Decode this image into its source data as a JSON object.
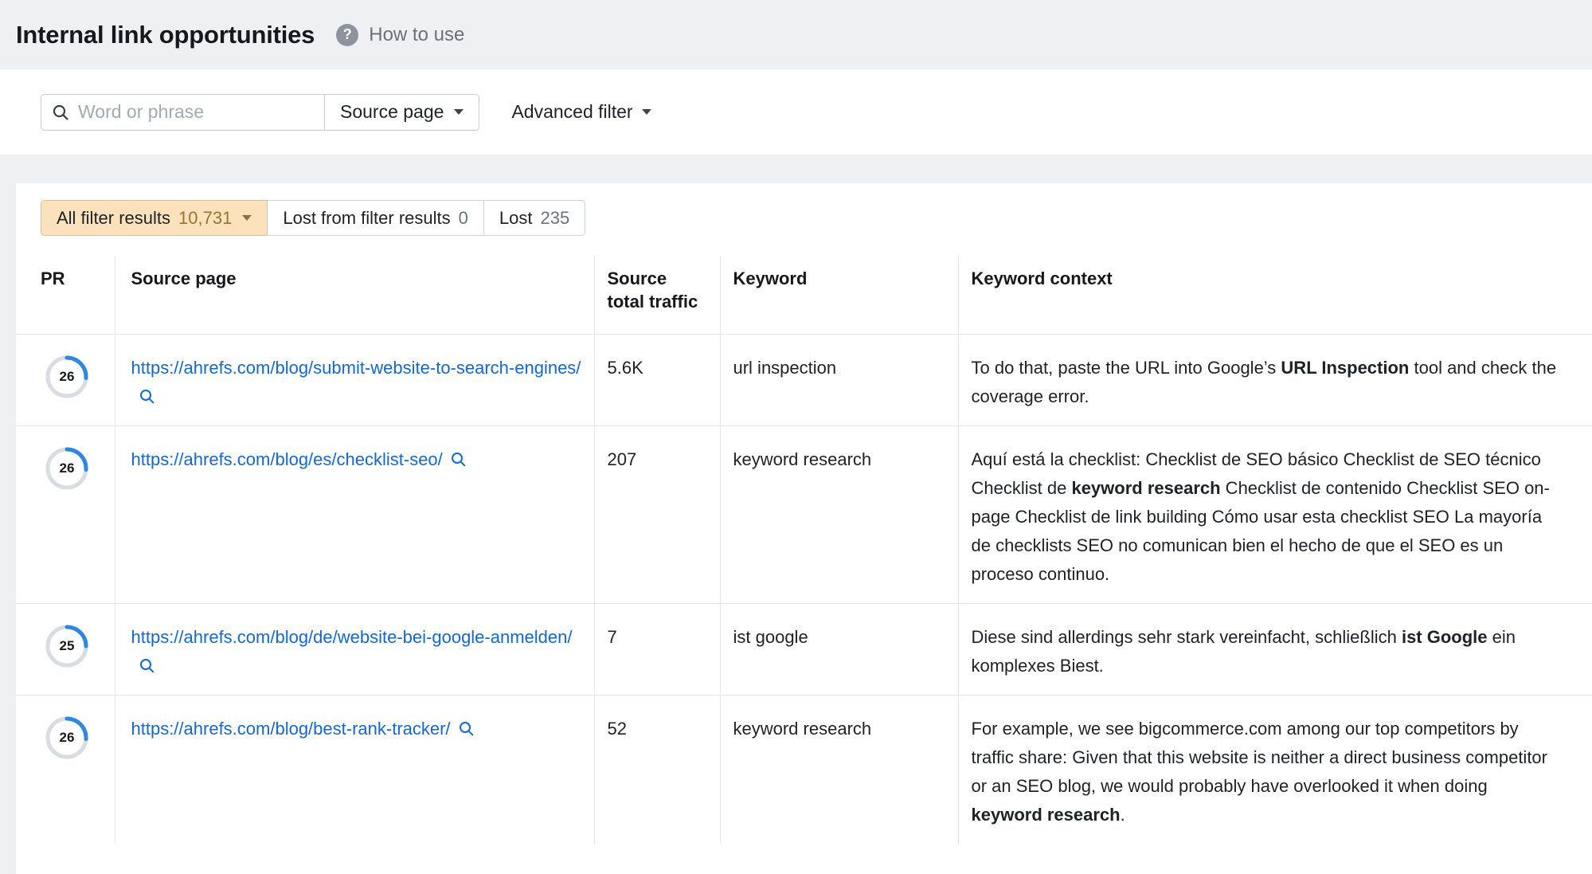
{
  "page": {
    "title": "Internal link opportunities",
    "help_glyph": "?",
    "help_label": "How to use"
  },
  "toolbar": {
    "search_placeholder": "Word or phrase",
    "source_page_label": "Source page",
    "advanced_filter_label": "Advanced filter"
  },
  "filters": {
    "tabs": [
      {
        "id": "all-filter-results",
        "label": "All filter results",
        "count": "10,731",
        "selected": true,
        "caret": true
      },
      {
        "id": "lost-from-filter-results",
        "label": "Lost from filter results",
        "count": "0",
        "selected": false,
        "caret": false
      },
      {
        "id": "lost",
        "label": "Lost",
        "count": "235",
        "selected": false,
        "caret": false
      }
    ]
  },
  "table": {
    "columns": [
      "PR",
      "Source page",
      "Source total traffic",
      "Keyword",
      "Keyword context"
    ],
    "rows": [
      {
        "pr": 26,
        "url": "https://ahrefs.com/blog/submit-website-to-search-engines/",
        "traffic": "5.6K",
        "keyword": "url inspection",
        "context": [
          {
            "text": "To do that, paste the URL into Google’s ",
            "bold": false
          },
          {
            "text": "URL Inspection",
            "bold": true
          },
          {
            "text": " tool and check the coverage error.",
            "bold": false
          }
        ]
      },
      {
        "pr": 26,
        "url": "https://ahrefs.com/blog/es/checklist-seo/",
        "traffic": "207",
        "keyword": "keyword research",
        "context": [
          {
            "text": "Aquí está la checklist: Checklist de SEO básico Checklist de SEO técnico Checklist de ",
            "bold": false
          },
          {
            "text": "keyword research",
            "bold": true
          },
          {
            "text": " Checklist de contenido Checklist SEO on-page Checklist de link building Cómo usar esta checklist SEO La mayoría de checklists SEO no comunican bien el hecho de que el SEO es un proceso continuo.",
            "bold": false
          }
        ]
      },
      {
        "pr": 25,
        "url": "https://ahrefs.com/blog/de/website-bei-google-anmelden/",
        "traffic": "7",
        "keyword": "ist google",
        "context": [
          {
            "text": "Diese sind allerdings sehr stark vereinfacht, schließlich ",
            "bold": false
          },
          {
            "text": "ist Google",
            "bold": true
          },
          {
            "text": " ein komplexes Biest.",
            "bold": false
          }
        ]
      },
      {
        "pr": 26,
        "url": "https://ahrefs.com/blog/best-rank-tracker/",
        "traffic": "52",
        "keyword": "keyword research",
        "context": [
          {
            "text": "For example, we see bigcommerce.com among our top competitors by traffic share: Given that this website is neither a direct business competitor or an SEO blog, we would probably have overlooked it when doing ",
            "bold": false
          },
          {
            "text": "keyword research",
            "bold": true
          },
          {
            "text": ".",
            "bold": false
          }
        ]
      }
    ]
  },
  "colors": {
    "accent_selected_bg": "#fbe2bd",
    "accent_selected_border": "#eebb76",
    "link_blue": "#1269d3",
    "pr_arc_blue": "#2e87e0",
    "pr_ring_gray": "#d9dde2"
  },
  "icons": {
    "search_icon": "magnifier",
    "help_icon": "question-mark-circle",
    "caret_down_icon": "triangle-down",
    "link_search_icon": "magnifier"
  }
}
